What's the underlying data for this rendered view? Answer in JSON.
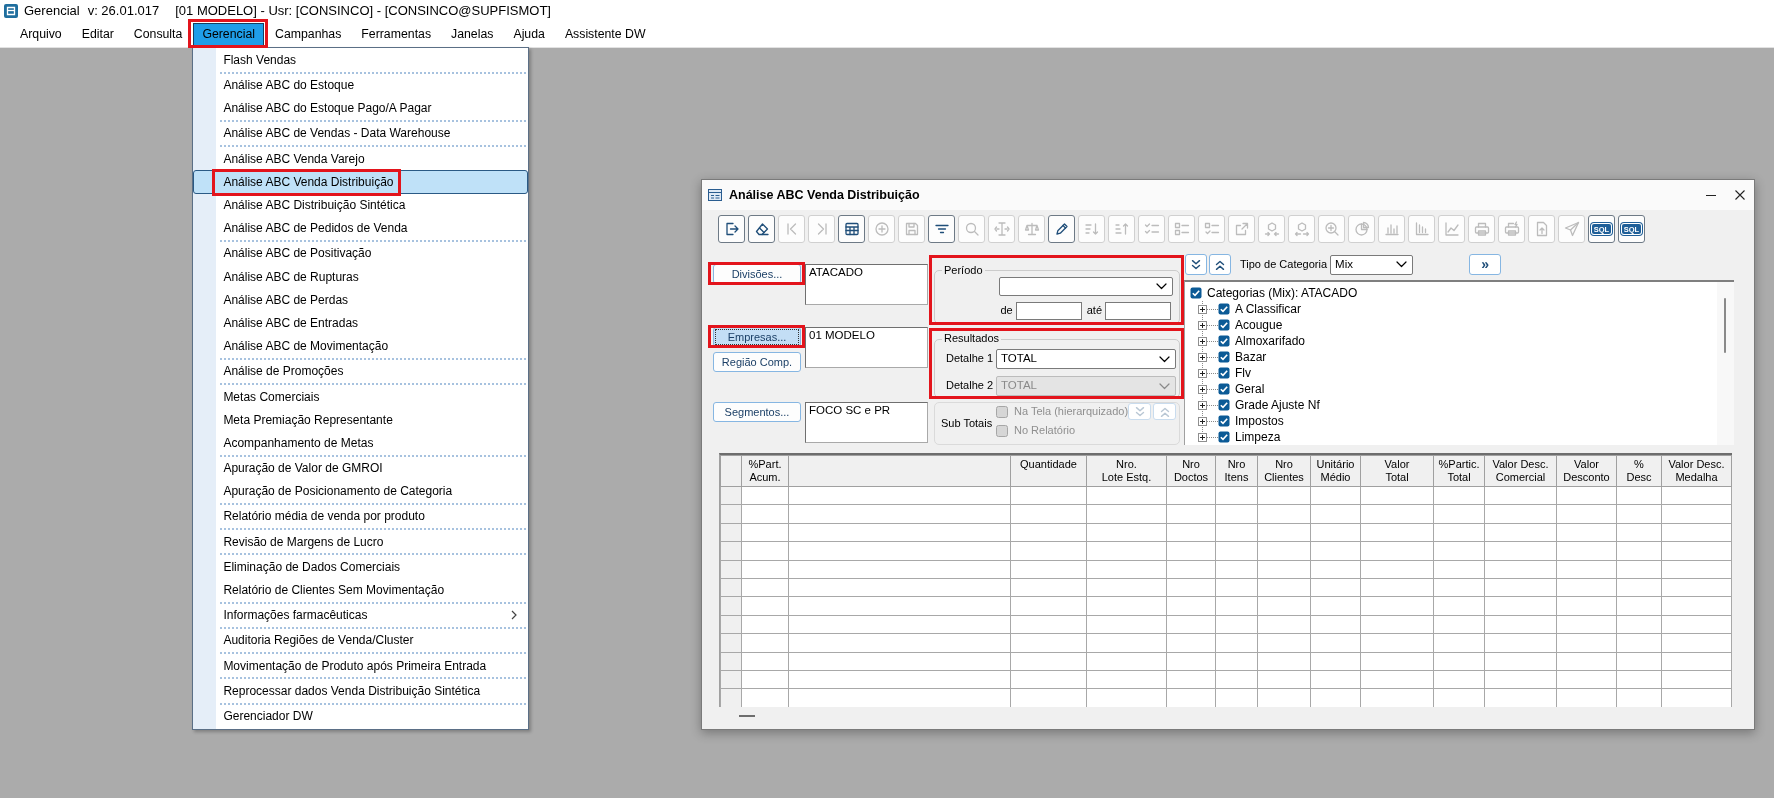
{
  "title_bar": {
    "app": "Gerencial",
    "version": "v: 26.01.017",
    "context": "[01 MODELO] - Usr: [CONSINCO] - [CONSINCO@SUPFISMOT]"
  },
  "menu_bar": [
    {
      "label": "Arquivo",
      "selected": false,
      "annotated": false
    },
    {
      "label": "Editar",
      "selected": false,
      "annotated": false
    },
    {
      "label": "Consulta",
      "selected": false,
      "annotated": false
    },
    {
      "label": "Gerencial",
      "selected": true,
      "annotated": true
    },
    {
      "label": "Campanhas",
      "selected": false,
      "annotated": false
    },
    {
      "label": "Ferramentas",
      "selected": false,
      "annotated": false
    },
    {
      "label": "Janelas",
      "selected": false,
      "annotated": false
    },
    {
      "label": "Ajuda",
      "selected": false,
      "annotated": false
    },
    {
      "label": "Assistente DW",
      "selected": false,
      "annotated": false
    }
  ],
  "dropdown": {
    "groups": [
      [
        {
          "label": "Flash Vendas",
          "selected": false,
          "annotated": false,
          "has_submenu": false
        }
      ],
      [
        {
          "label": "Análise ABC do Estoque",
          "selected": false,
          "annotated": false,
          "has_submenu": false
        },
        {
          "label": "Análise ABC do Estoque Pago/A Pagar",
          "selected": false,
          "annotated": false,
          "has_submenu": false
        }
      ],
      [
        {
          "label": "Análise ABC de Vendas - Data Warehouse",
          "selected": false,
          "annotated": false,
          "has_submenu": false
        }
      ],
      [
        {
          "label": "Análise ABC Venda Varejo",
          "selected": false,
          "annotated": false,
          "has_submenu": false
        },
        {
          "label": "Análise ABC Venda Distribuição",
          "selected": true,
          "annotated": true,
          "has_submenu": false
        },
        {
          "label": "Análise ABC Distribuição Sintética",
          "selected": false,
          "annotated": false,
          "has_submenu": false
        },
        {
          "label": "Análise ABC de Pedidos de Venda",
          "selected": false,
          "annotated": false,
          "has_submenu": false
        }
      ],
      [
        {
          "label": "Análise ABC de Positivação",
          "selected": false,
          "annotated": false,
          "has_submenu": false
        },
        {
          "label": "Análise ABC de Rupturas",
          "selected": false,
          "annotated": false,
          "has_submenu": false
        },
        {
          "label": "Análise ABC de Perdas",
          "selected": false,
          "annotated": false,
          "has_submenu": false
        },
        {
          "label": "Análise ABC de Entradas",
          "selected": false,
          "annotated": false,
          "has_submenu": false
        },
        {
          "label": "Análise ABC de Movimentação",
          "selected": false,
          "annotated": false,
          "has_submenu": false
        }
      ],
      [
        {
          "label": "Análise de Promoções",
          "selected": false,
          "annotated": false,
          "has_submenu": false
        }
      ],
      [
        {
          "label": "Metas Comerciais",
          "selected": false,
          "annotated": false,
          "has_submenu": false
        },
        {
          "label": "Meta Premiação Representante",
          "selected": false,
          "annotated": false,
          "has_submenu": false
        },
        {
          "label": "Acompanhamento de Metas",
          "selected": false,
          "annotated": false,
          "has_submenu": false
        }
      ],
      [
        {
          "label": "Apuração de Valor de GMROI",
          "selected": false,
          "annotated": false,
          "has_submenu": false
        },
        {
          "label": "Apuração de Posicionamento de Categoria",
          "selected": false,
          "annotated": false,
          "has_submenu": false
        }
      ],
      [
        {
          "label": "Relatório média de venda por produto",
          "selected": false,
          "annotated": false,
          "has_submenu": false
        }
      ],
      [
        {
          "label": "Revisão de Margens de Lucro",
          "selected": false,
          "annotated": false,
          "has_submenu": false
        }
      ],
      [
        {
          "label": "Eliminação de Dados Comerciais",
          "selected": false,
          "annotated": false,
          "has_submenu": false
        },
        {
          "label": "Relatório de Clientes Sem Movimentação",
          "selected": false,
          "annotated": false,
          "has_submenu": false
        }
      ],
      [
        {
          "label": "Informações farmacêuticas",
          "selected": false,
          "annotated": false,
          "has_submenu": true
        }
      ],
      [
        {
          "label": "Auditoria Regiões de Venda/Cluster",
          "selected": false,
          "annotated": false,
          "has_submenu": false
        }
      ],
      [
        {
          "label": "Movimentação de Produto após Primeira Entrada",
          "selected": false,
          "annotated": false,
          "has_submenu": false
        }
      ],
      [
        {
          "label": "Reprocessar dados Venda Distribuição Sintética",
          "selected": false,
          "annotated": false,
          "has_submenu": false
        }
      ],
      [
        {
          "label": "Gerenciador DW",
          "selected": false,
          "annotated": false,
          "has_submenu": false
        }
      ]
    ]
  },
  "window": {
    "title": "Análise ABC Venda Distribuição",
    "toolbar": [
      {
        "disabled": false
      },
      {
        "disabled": false
      },
      {
        "disabled": true
      },
      {
        "disabled": true
      },
      {
        "disabled": false
      },
      {
        "disabled": true
      },
      {
        "disabled": true
      },
      {
        "disabled": false
      },
      {
        "disabled": true
      },
      {
        "disabled": true
      },
      {
        "disabled": true
      },
      {
        "disabled": false
      },
      {
        "disabled": true
      },
      {
        "disabled": true
      },
      {
        "disabled": true
      },
      {
        "disabled": true
      },
      {
        "disabled": true
      },
      {
        "disabled": true
      },
      {
        "disabled": true
      },
      {
        "disabled": true
      },
      {
        "disabled": true
      },
      {
        "disabled": true
      },
      {
        "disabled": true
      },
      {
        "disabled": true
      },
      {
        "disabled": true
      },
      {
        "disabled": true
      },
      {
        "disabled": true
      },
      {
        "disabled": true
      },
      {
        "disabled": true
      },
      {
        "label": "SQL",
        "disabled": false
      },
      {
        "label": "SQL",
        "disabled": false
      }
    ],
    "selectors": [
      {
        "buttons": [
          {
            "label": "Divisões...",
            "focused": false,
            "annotated": true
          }
        ],
        "value": "ATACADO"
      },
      {
        "buttons": [
          {
            "label": "Empresas...",
            "focused": true,
            "annotated": true
          },
          {
            "label": "Região Comp.",
            "focused": false,
            "annotated": false
          }
        ],
        "value": "01 MODELO"
      },
      {
        "buttons": [
          {
            "label": "Segmentos...",
            "focused": false,
            "annotated": false
          }
        ],
        "value": "FOCO SC e PR"
      }
    ],
    "period": {
      "legend": "Período",
      "annotated": true,
      "from_label": "de",
      "to_label": "até"
    },
    "results": {
      "legend": "Resultados",
      "annotated": true,
      "details": [
        {
          "label": "Detalhe 1",
          "value": "TOTAL",
          "disabled": false
        },
        {
          "label": "Detalhe 2",
          "value": "TOTAL",
          "disabled": true
        }
      ]
    },
    "subtotals": {
      "label": "Sub Totais",
      "options": [
        {
          "label": "Na Tela (hierarquizado)",
          "checked": false,
          "disabled": true
        },
        {
          "label": "No Relatório",
          "checked": false,
          "disabled": true
        }
      ],
      "buttons": [
        {
          "disabled": true
        },
        {
          "disabled": true
        }
      ]
    },
    "category": {
      "buttons": [
        {
          "disabled": false
        },
        {
          "disabled": false
        }
      ],
      "type_label": "Tipo de Categoria",
      "type_value": "Mix",
      "apply_button": "»"
    },
    "tree": {
      "label": "Categorias (Mix): ATACADO",
      "checked": true,
      "children": [
        {
          "label": "A Classificar",
          "checked": true,
          "expanded": false
        },
        {
          "label": "Acougue",
          "checked": true,
          "expanded": false
        },
        {
          "label": "Almoxarifado",
          "checked": true,
          "expanded": false
        },
        {
          "label": "Bazar",
          "checked": true,
          "expanded": false
        },
        {
          "label": "Flv",
          "checked": true,
          "expanded": false
        },
        {
          "label": "Geral",
          "checked": true,
          "expanded": false
        },
        {
          "label": "Grade Ajuste Nf",
          "checked": true,
          "expanded": false
        },
        {
          "label": "Impostos",
          "checked": true,
          "expanded": false
        },
        {
          "label": "Limpeza",
          "checked": true,
          "expanded": false
        }
      ]
    },
    "table": {
      "columns": [
        {
          "label": "%Part.\nAcum."
        },
        {},
        {
          "label": "Quantidade"
        },
        {
          "label": "Nro.\nLote Estq."
        },
        {
          "label": "Nro\nDoctos"
        },
        {
          "label": "Nro\nItens"
        },
        {
          "label": "Nro\nClientes"
        },
        {
          "label": "Unitário\nMédio"
        },
        {
          "label": "Valor\nTotal"
        },
        {
          "label": "%Partic.\nTotal"
        },
        {
          "label": "Valor Desc.\nComercial"
        },
        {
          "label": "Valor\nDesconto"
        },
        {
          "label": "%\nDesc"
        },
        {
          "label": "Valor Desc.\nMedalha"
        }
      ]
    }
  }
}
